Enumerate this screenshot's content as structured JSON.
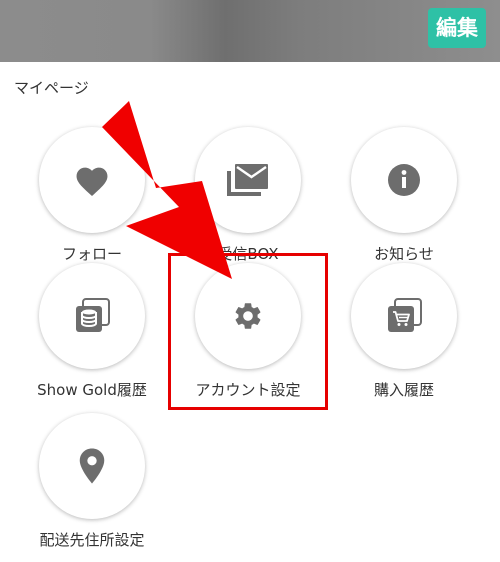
{
  "header": {
    "edit_label": "編集"
  },
  "section": {
    "title": "マイページ"
  },
  "items": [
    {
      "label": "フォロー",
      "icon": "heart-icon"
    },
    {
      "label": "受信BOX",
      "icon": "mail-icon"
    },
    {
      "label": "お知らせ",
      "icon": "info-icon"
    },
    {
      "label": "Show Gold履歴",
      "icon": "coin-stack-icon"
    },
    {
      "label": "アカウント設定",
      "icon": "gear-icon"
    },
    {
      "label": "購入履歴",
      "icon": "cart-icon"
    },
    {
      "label": "配送先住所設定",
      "icon": "location-pin-icon"
    }
  ],
  "colors": {
    "accent": "#2ec1a6",
    "highlight": "#e60000",
    "icon": "#6d6d6d"
  }
}
